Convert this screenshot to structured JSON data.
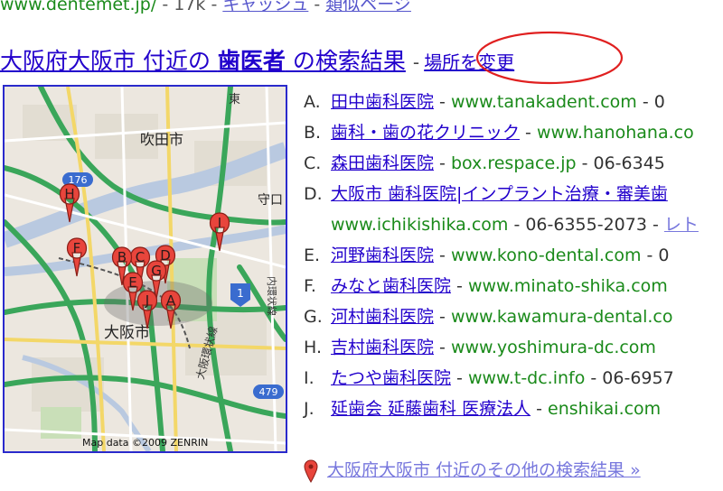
{
  "top": {
    "url": "www.dentemet.jp/",
    "size": "17k",
    "cache": "キャッシュ",
    "similar": "類似ページ",
    "sep1": " - ",
    "sep2": " - "
  },
  "heading": {
    "prefix": "大阪府大阪市 付近の ",
    "keyword": "歯医者",
    "suffix": " の検索結果",
    "dash": "-",
    "change_location": "場所を変更"
  },
  "map": {
    "city_suita": "吹田市",
    "city_osaka": "大阪市",
    "city_moriguchi": "守口",
    "road_176": "176",
    "road_479": "479",
    "road_1": "1",
    "road_higashi": "東",
    "road_naikanjosen": "内環状線",
    "road_osakakanjosen": "大阪環状線",
    "attribution": "Map data ©2009 ZENRIN",
    "markers": [
      "H",
      "F",
      "I",
      "D",
      "C",
      "B",
      "E",
      "G",
      "J",
      "A"
    ]
  },
  "results": [
    {
      "letter": "A.",
      "name": "田中歯科医院",
      "url": "www.tanakadent.com",
      "phone": "0"
    },
    {
      "letter": "B.",
      "name": "歯科・歯の花クリニック",
      "url": "www.hanohana.co",
      "phone": ""
    },
    {
      "letter": "C.",
      "name": "森田歯科医院",
      "url": "box.respace.jp",
      "phone": "06-6345"
    },
    {
      "letter": "D.",
      "name": "大阪市 歯科医院|インプラント治療・審美歯",
      "url": "",
      "phone": ""
    },
    {
      "letter": "",
      "name": "",
      "url": "www.ichikishika.com",
      "phone": "06-6355-2073",
      "more": "レト"
    },
    {
      "letter": "E.",
      "name": "河野歯科医院",
      "url": "www.kono-dental.com",
      "phone": "0"
    },
    {
      "letter": "F.",
      "name": "みなと歯科医院",
      "url": "www.minato-shika.com",
      "phone": ""
    },
    {
      "letter": "G.",
      "name": "河村歯科医院",
      "url": "www.kawamura-dental.co",
      "phone": ""
    },
    {
      "letter": "H.",
      "name": "吉村歯科医院",
      "url": "www.yoshimura-dc.com",
      "phone": ""
    },
    {
      "letter": "I.",
      "name": "たつや歯科医院",
      "url": "www.t-dc.info",
      "phone": "06-6957"
    },
    {
      "letter": "J.",
      "name": "延歯会 延藤歯科 医療法人",
      "url": "enshikai.com",
      "phone": ""
    }
  ],
  "footer": {
    "more_results": "大阪府大阪市 付近のその他の検索結果 »"
  },
  "colors": {
    "link": "#2200cc",
    "url_green": "#1a8a1a",
    "marker_red": "#e8453c",
    "annotation_red": "#e02020"
  }
}
